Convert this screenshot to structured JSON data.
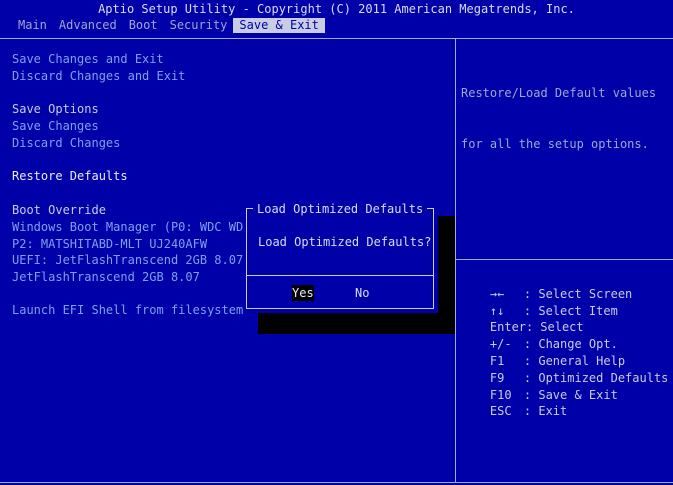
{
  "header": {
    "title": "Aptio Setup Utility - Copyright (C) 2011 American Megatrends, Inc."
  },
  "tabs": [
    {
      "label": "Main",
      "active": false
    },
    {
      "label": "Advanced",
      "active": false
    },
    {
      "label": "Boot",
      "active": false
    },
    {
      "label": "Security",
      "active": false
    },
    {
      "label": "Save & Exit",
      "active": true
    }
  ],
  "menu": {
    "save_changes_and_exit": "Save Changes and Exit",
    "discard_changes_and_exit": "Discard Changes and Exit",
    "save_options_heading": "Save Options",
    "save_changes": "Save Changes",
    "discard_changes": "Discard Changes",
    "restore_defaults": "Restore Defaults",
    "boot_override_heading": "Boot Override",
    "boot_options": [
      "Windows Boot Manager (P0: WDC WD7",
      "P2: MATSHITABD-MLT UJ240AFW",
      "UEFI: JetFlashTranscend 2GB 8.07",
      "JetFlashTranscend 2GB 8.07"
    ],
    "launch_efi_shell": "Launch EFI Shell from filesystem"
  },
  "help": {
    "description_line1": "Restore/Load Default values",
    "description_line2": "for all the setup options.",
    "keys": [
      {
        "key": "→←",
        "desc": ": Select Screen"
      },
      {
        "key": "↑↓",
        "desc": ": Select Item"
      },
      {
        "key": "Enter:",
        "desc": "Select"
      },
      {
        "key": "+/-",
        "desc": ": Change Opt."
      },
      {
        "key": "F1",
        "desc": ": General Help"
      },
      {
        "key": "F9",
        "desc": ": Optimized Defaults"
      },
      {
        "key": "F10",
        "desc": ": Save & Exit"
      },
      {
        "key": "ESC",
        "desc": ": Exit"
      }
    ]
  },
  "dialog": {
    "title": "Load Optimized Defaults",
    "message": "Load Optimized Defaults?",
    "yes_label": "Yes",
    "no_label": "No",
    "selected": "Yes"
  },
  "colors": {
    "background": "#0000a8",
    "link": "#7fa0f0",
    "text": "#c8cce4",
    "active_tab_bg": "#c8cce4"
  }
}
